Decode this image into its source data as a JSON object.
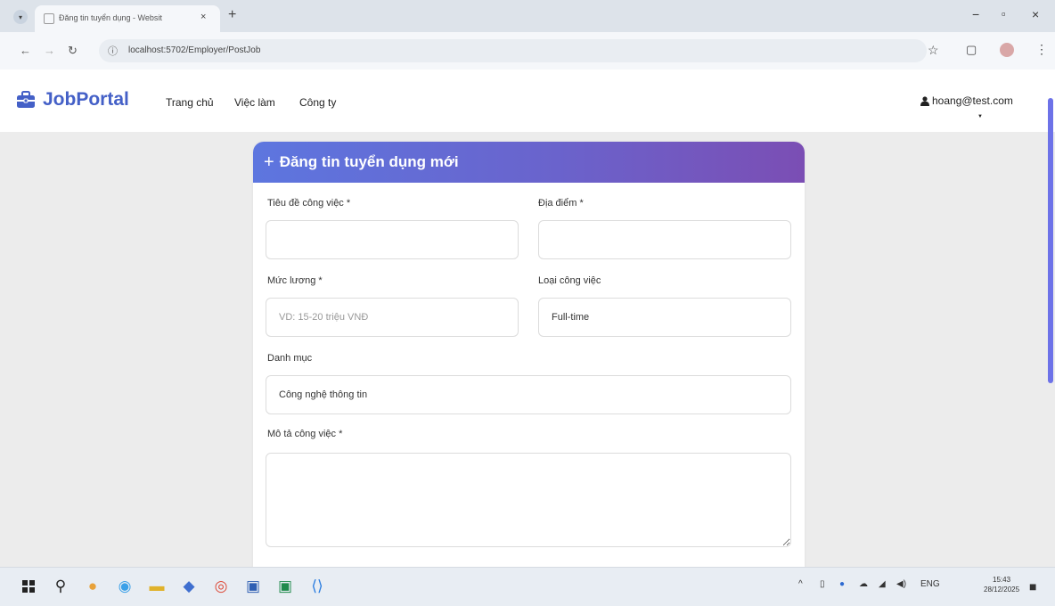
{
  "browser": {
    "tab_title": "Đăng tin tuyển dụng - Websit",
    "tab_close": "×",
    "new_tab": "+",
    "url": "localhost:5702/Employer/PostJob",
    "window_controls": {
      "minimize": "−",
      "maximize": "▫",
      "close": "×"
    }
  },
  "navbar": {
    "brand": "JobPortal",
    "links": [
      "Trang chủ",
      "Việc làm",
      "Công ty"
    ],
    "user": "hoang@test.com"
  },
  "form": {
    "title": "Đăng tin tuyển dụng mới",
    "job_title": {
      "label": "Tiêu đề công việc *",
      "value": ""
    },
    "location": {
      "label": "Địa điểm *",
      "value": ""
    },
    "salary": {
      "label": "Mức lương *",
      "placeholder": "VD: 15-20 triệu VNĐ"
    },
    "job_type": {
      "label": "Loại công việc",
      "value": "Full-time"
    },
    "category": {
      "label": "Danh mục",
      "value": "Công nghệ thông tin"
    },
    "description": {
      "label": "Mô tả công việc *",
      "value": ""
    }
  },
  "taskbar": {
    "tray": {
      "language": "ENG",
      "time": "15:43",
      "date": "28/12/2025"
    }
  },
  "colors": {
    "brand": "#4460c7",
    "header_gradient_start": "#5d76df",
    "header_gradient_end": "#7b4eb4",
    "scrollbar": "#6d72e8"
  },
  "icons": {
    "brand": "briefcase-icon",
    "user": "user-icon",
    "form_title": "plus-icon"
  }
}
